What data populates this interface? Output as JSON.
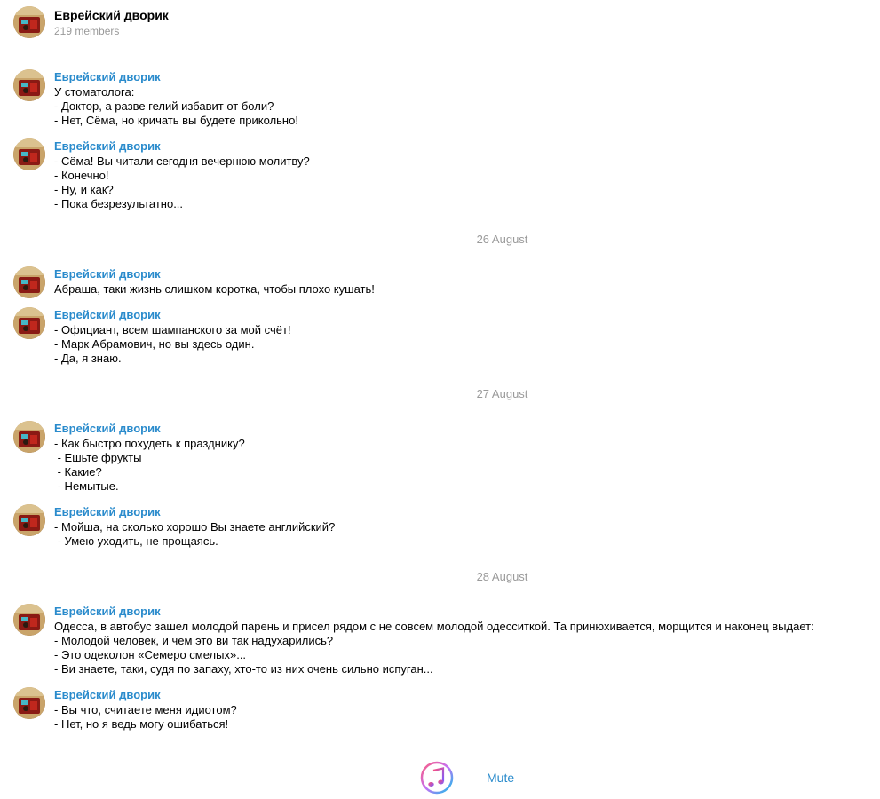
{
  "header": {
    "title": "Еврейский дворик",
    "members": "219 members"
  },
  "messages": [
    {
      "author": "Еврейский дворик",
      "text": "У стоматолога:\n- Доктор, а разве гелий избавит от боли?\n- Нет, Сёма, но кричать вы будете прикольно!"
    },
    {
      "author": "Еврейский дворик",
      "text": "- Сёма! Вы читали сегодня вечернюю молитву?\n- Конечно!\n- Ну, и как?\n- Пока безрезультатно..."
    },
    {
      "author": "Еврейский дворик",
      "text": "Абраша, таки жизнь слишком коротка, чтобы плохо кушать!"
    },
    {
      "author": "Еврейский дворик",
      "text": "- Официант, всем шампанского за мой счёт!\n- Марк Абрамович, но вы здесь один.\n- Да, я знаю."
    },
    {
      "author": "Еврейский дворик",
      "text": "- Как быстро похудеть к празднику?\n - Ешьте фрукты\n - Какие?\n - Немытые."
    },
    {
      "author": "Еврейский дворик",
      "text": "- Мойша, на сколько хорошо Вы знаете английский?\n - Умею уходить, не прощаясь."
    },
    {
      "author": "Еврейский дворик",
      "text": "Одесса, в автобус зашел молодой парень и присел рядом с не совсем молодой одесситкой. Та принюхивается, морщится и наконец выдает:\n- Молодой человек, и чем это ви так надухарились?\n- Это одеколон «Семеро смелых»...\n- Ви знаете, таки, судя по запаху, хто-то из них очень сильно испуган..."
    },
    {
      "author": "Еврейский дворик",
      "text": "- Вы что, считаете меня идиотом?\n- Нет, но я ведь могу ошибаться!"
    }
  ],
  "date_separators": [
    "26 August",
    "27 August",
    "28 August"
  ],
  "footer": {
    "mute_label": "Mute",
    "icon": "music-note-icon"
  },
  "colors": {
    "accent": "#2a8bcc",
    "muted": "#9a9a9a"
  }
}
